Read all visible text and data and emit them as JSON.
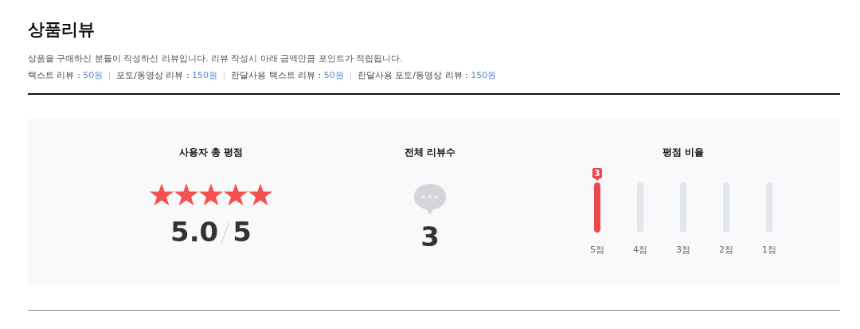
{
  "title": "상품리뷰",
  "description": "상품을 구매하신 분들이 작성하신 리뷰입니다. 리뷰 작성시 아래 금액만큼 포인트가 적립됩니다.",
  "points": [
    {
      "label": "텍스트 리뷰 : ",
      "amount": "50원"
    },
    {
      "label": "포토/동영상 리뷰 : ",
      "amount": "150원"
    },
    {
      "label": "한달사용 텍스트 리뷰 : ",
      "amount": "50원"
    },
    {
      "label": "한달사용 포토/동영상 리뷰 : ",
      "amount": "150원"
    }
  ],
  "summary": {
    "rating": {
      "heading": "사용자 총 평점",
      "stars": 5,
      "score": "5.0",
      "max": "5"
    },
    "reviews": {
      "heading": "전체 리뷰수",
      "count": "3"
    },
    "ratio": {
      "heading": "평점 비율",
      "bars": [
        {
          "label": "5점",
          "level": 1,
          "count": "3"
        },
        {
          "label": "4점",
          "level": 0
        },
        {
          "label": "3점",
          "level": 0
        },
        {
          "label": "2점",
          "level": 0
        },
        {
          "label": "1점",
          "level": 0
        }
      ]
    }
  }
}
